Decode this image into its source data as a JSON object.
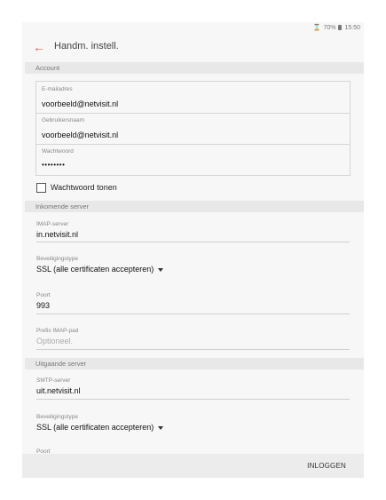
{
  "status_bar": {
    "battery": "70%",
    "time": "15:50",
    "signal_icon": "hourglass-icon"
  },
  "app_bar": {
    "title": "Handm. instell."
  },
  "account": {
    "section_title": "Account",
    "email_label": "E-mailadres",
    "email_value": "voorbeeld@netvisit.nl",
    "username_label": "Gebruikersnaam",
    "username_value": "voorbeeld@netvisit.nl",
    "password_label": "Wachtwoord",
    "password_value": "••••••••",
    "show_password_label": "Wachtwoord tonen"
  },
  "incoming": {
    "section_title": "Inkomende server",
    "server_label": "IMAP-server",
    "server_value": "in.netvisit.nl",
    "security_label": "Beveiligingstype",
    "security_value": "SSL (alle certificaten accepteren)",
    "port_label": "Poort",
    "port_value": "993",
    "prefix_label": "Prefix IMAP-pad",
    "prefix_placeholder": "Optioneel."
  },
  "outgoing": {
    "section_title": "Uitgaande server",
    "server_label": "SMTP-server",
    "server_value": "uit.netvisit.nl",
    "security_label": "Beveiligingstype",
    "security_value": "SSL (alle certificaten accepteren)",
    "port_label": "Poort"
  },
  "bottom_bar": {
    "login_label": "INLOGGEN"
  },
  "colors": {
    "accent": "#e8613c",
    "section_bg": "#e8e8e8",
    "screen_bg": "#f7f7f7"
  }
}
